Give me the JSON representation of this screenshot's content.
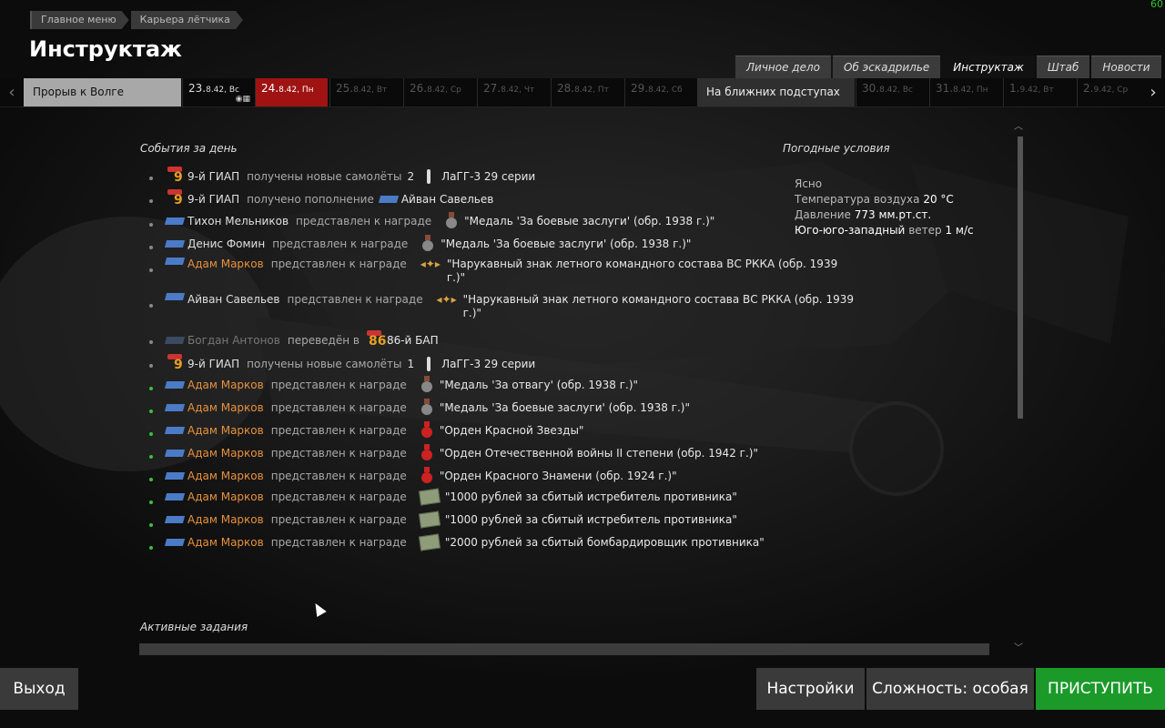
{
  "fps": "60",
  "breadcrumb": [
    "Главное меню",
    "Карьера лётчика"
  ],
  "page_title": "Инструктаж",
  "top_tabs": [
    {
      "label": "Личное дело",
      "active": false
    },
    {
      "label": "Об эскадрилье",
      "active": false
    },
    {
      "label": "Инструктаж",
      "active": true
    },
    {
      "label": "Штаб",
      "active": false
    },
    {
      "label": "Новости",
      "active": false
    }
  ],
  "timeline": {
    "operation_left": "Прорыв к Волге",
    "operation_right": "На ближних подступах",
    "days": [
      {
        "day": "23.",
        "rest": "8.42, Вс",
        "state": "past"
      },
      {
        "day": "24.",
        "rest": "8.42, Пн",
        "state": "current"
      },
      {
        "day": "25.",
        "rest": "8.42, Вт",
        "state": "future"
      },
      {
        "day": "26.",
        "rest": "8.42, Ср",
        "state": "future"
      },
      {
        "day": "27.",
        "rest": "8.42, Чт",
        "state": "future"
      },
      {
        "day": "28.",
        "rest": "8.42, Пт",
        "state": "future"
      },
      {
        "day": "29.",
        "rest": "8.42, Сб",
        "state": "future"
      },
      {
        "day": "30.",
        "rest": "8.42, Вс",
        "state": "future"
      },
      {
        "day": "31.",
        "rest": "8.42, Пн",
        "state": "future"
      },
      {
        "day": "1.",
        "rest": "9.42, Вт",
        "state": "future"
      },
      {
        "day": "2.",
        "rest": "9.42, Ср",
        "state": "future"
      }
    ]
  },
  "events_title": "События за день",
  "events": [
    {
      "type": "unit",
      "actor": "9-й ГИАП",
      "actor_style": "white",
      "verb": "получены новые самолёты",
      "count": "2",
      "obj_icon": "plane",
      "obj": "ЛаГГ-3 29 серии",
      "new": false
    },
    {
      "type": "unit",
      "actor": "9-й ГИАП",
      "actor_style": "white",
      "verb": "получено пополнение",
      "obj_icon": "flag",
      "obj": "Айван Савельев",
      "new": false
    },
    {
      "type": "pilot",
      "actor": "Тихон Мельников",
      "actor_style": "white",
      "verb": "представлен к награде",
      "obj_icon": "medal",
      "obj": "\"Медаль 'За боевые заслуги' (обр. 1938 г.)\"",
      "new": false
    },
    {
      "type": "pilot",
      "actor": "Денис Фомин",
      "actor_style": "white",
      "verb": "представлен к награде",
      "obj_icon": "medal",
      "obj": "\"Медаль 'За боевые заслуги' (обр. 1938 г.)\"",
      "new": false
    },
    {
      "type": "pilot",
      "actor": "Адам Марков",
      "actor_style": "orange",
      "verb": "представлен к награде",
      "obj_icon": "wings",
      "obj": "\"Нарукавный знак летного командного состава ВС РККА (обр. 1939",
      "obj2": "г.)\"",
      "new": false
    },
    {
      "type": "pilot",
      "actor": "Айван Савельев",
      "actor_style": "white",
      "verb": "представлен к награде",
      "obj_icon": "wings",
      "obj": "\"Нарукавный знак летного командного состава ВС РККА (обр. 1939",
      "obj2": "г.)\"",
      "new": false
    },
    {
      "type": "pilot",
      "actor": "Богдан Антонов",
      "actor_style": "faded",
      "verb": "переведён в",
      "obj_icon": "unit86",
      "obj": "86-й БАП",
      "new": false
    },
    {
      "type": "unit",
      "actor": "9-й ГИАП",
      "actor_style": "white",
      "verb": "получены новые самолёты",
      "count": "1",
      "obj_icon": "plane",
      "obj": "ЛаГГ-3 29 серии",
      "new": false
    },
    {
      "type": "pilot",
      "actor": "Адам Марков",
      "actor_style": "orange",
      "verb": "представлен к награде",
      "obj_icon": "medal",
      "obj": "\"Медаль 'За отвагу' (обр. 1938 г.)\"",
      "new": true
    },
    {
      "type": "pilot",
      "actor": "Адам Марков",
      "actor_style": "orange",
      "verb": "представлен к награде",
      "obj_icon": "medal",
      "obj": "\"Медаль 'За боевые заслуги' (обр. 1938 г.)\"",
      "new": true
    },
    {
      "type": "pilot",
      "actor": "Адам Марков",
      "actor_style": "orange",
      "verb": "представлен к награде",
      "obj_icon": "order-red",
      "obj": "\"Орден Красной Звезды\"",
      "new": true
    },
    {
      "type": "pilot",
      "actor": "Адам Марков",
      "actor_style": "orange",
      "verb": "представлен к награде",
      "obj_icon": "order-red",
      "obj": "\"Орден Отечественной войны II степени (обр. 1942 г.)\"",
      "new": true
    },
    {
      "type": "pilot",
      "actor": "Адам Марков",
      "actor_style": "orange",
      "verb": "представлен к награде",
      "obj_icon": "order-red",
      "obj": "\"Орден Красного Знамени (обр. 1924 г.)\"",
      "new": true
    },
    {
      "type": "pilot",
      "actor": "Адам Марков",
      "actor_style": "orange",
      "verb": "представлен к награде",
      "obj_icon": "money",
      "obj": "\"1000 рублей за сбитый истребитель противника\"",
      "new": true
    },
    {
      "type": "pilot",
      "actor": "Адам Марков",
      "actor_style": "orange",
      "verb": "представлен к награде",
      "obj_icon": "money",
      "obj": "\"1000 рублей за сбитый истребитель противника\"",
      "new": true
    },
    {
      "type": "pilot",
      "actor": "Адам Марков",
      "actor_style": "orange",
      "verb": "представлен к награде",
      "obj_icon": "money",
      "obj": "\"2000 рублей за сбитый бомбардировщик противника\"",
      "new": true
    }
  ],
  "weather": {
    "title": "Погодные условия",
    "sky": "Ясно",
    "temp_label": "Температура воздуха",
    "temp_value": "20 °C",
    "pressure_label": "Давление",
    "pressure_value": "773 мм.рт.ст.",
    "wind_dir": "Юго-юго-западный",
    "wind_label": "ветер",
    "wind_value": "1 м/с"
  },
  "tasks_title": "Активные задания",
  "buttons": {
    "exit": "Выход",
    "settings": "Настройки",
    "difficulty": "Сложность: особая",
    "start": "ПРИСТУПИТЬ"
  },
  "colors": {
    "start": "#1b9a2a",
    "current_day": "#a01313",
    "highlight_name": "#e8913c"
  }
}
